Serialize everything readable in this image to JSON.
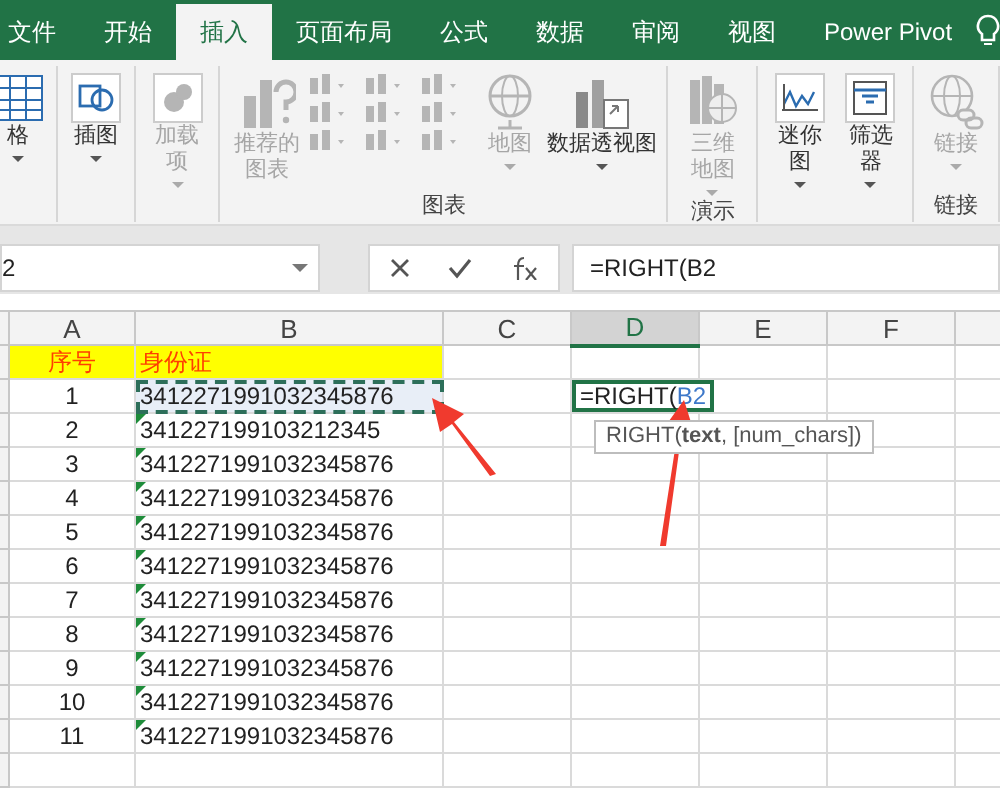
{
  "ribbon_tabs": [
    {
      "label": "文件",
      "selected": false
    },
    {
      "label": "开始",
      "selected": false
    },
    {
      "label": "插入",
      "selected": true
    },
    {
      "label": "页面布局",
      "selected": false
    },
    {
      "label": "公式",
      "selected": false
    },
    {
      "label": "数据",
      "selected": false
    },
    {
      "label": "审阅",
      "selected": false
    },
    {
      "label": "视图",
      "selected": false
    },
    {
      "label": "Power Pivot",
      "selected": false
    }
  ],
  "ribbon_groups": [
    {
      "items": [
        {
          "kind": "table",
          "label": "格",
          "dropdown": true,
          "disabled": false
        }
      ]
    },
    {
      "items": [
        {
          "kind": "shapes",
          "label": "插图",
          "dropdown": true,
          "disabled": false
        }
      ]
    },
    {
      "items": [
        {
          "kind": "addin",
          "label": "加载项",
          "dropdown": true,
          "disabled": true
        }
      ]
    },
    {
      "label": "图表",
      "items": [
        {
          "kind": "recommended",
          "label": "推荐的图表",
          "dropdown": false,
          "disabled": true
        },
        {
          "kind": "gallery",
          "dropdown": false,
          "disabled": true
        },
        {
          "kind": "globe",
          "label": "地图",
          "dropdown": true,
          "disabled": true
        },
        {
          "kind": "pivot",
          "label": "数据透视图",
          "dropdown": true,
          "disabled": false
        }
      ]
    },
    {
      "label": "演示",
      "items": [
        {
          "kind": "map3d",
          "label": "三维地图",
          "dropdown": true,
          "disabled": true
        }
      ]
    },
    {
      "items": [
        {
          "kind": "sparkline",
          "label": "迷你图",
          "dropdown": true,
          "disabled": false
        },
        {
          "kind": "filter",
          "label": "筛选器",
          "dropdown": true,
          "disabled": false
        }
      ]
    },
    {
      "label": "链接",
      "items": [
        {
          "kind": "link",
          "label": "链接",
          "dropdown": true,
          "disabled": true
        }
      ]
    }
  ],
  "formula_bar": {
    "name_box": "2",
    "formula": "=RIGHT(B2"
  },
  "columns": [
    {
      "label": "A",
      "selected": false
    },
    {
      "label": "B",
      "selected": false
    },
    {
      "label": "C",
      "selected": false
    },
    {
      "label": "D",
      "selected": true
    },
    {
      "label": "E",
      "selected": false
    },
    {
      "label": "F",
      "selected": false
    }
  ],
  "rows": [
    {
      "kind": "header",
      "number": "序号",
      "id": "身份证"
    },
    {
      "kind": "data",
      "number": "1",
      "id": "3412271991032345876",
      "error_mark": false,
      "copy_marquee": true,
      "editing": {
        "text": "=RIGHT(",
        "reference": "B2",
        "tooltip": "RIGHT(**text**, [num_chars])"
      }
    },
    {
      "kind": "data",
      "number": "2",
      "id": "341227199103212345",
      "error_mark": true,
      "copy_marquee": false
    },
    {
      "kind": "data",
      "number": "3",
      "id": "3412271991032345876",
      "error_mark": true,
      "copy_marquee": false
    },
    {
      "kind": "data",
      "number": "4",
      "id": "3412271991032345876",
      "error_mark": true,
      "copy_marquee": false
    },
    {
      "kind": "data",
      "number": "5",
      "id": "3412271991032345876",
      "error_mark": true,
      "copy_marquee": false
    },
    {
      "kind": "data",
      "number": "6",
      "id": "3412271991032345876",
      "error_mark": true,
      "copy_marquee": false
    },
    {
      "kind": "data",
      "number": "7",
      "id": "3412271991032345876",
      "error_mark": true,
      "copy_marquee": false
    },
    {
      "kind": "data",
      "number": "8",
      "id": "3412271991032345876",
      "error_mark": true,
      "copy_marquee": false
    },
    {
      "kind": "data",
      "number": "9",
      "id": "3412271991032345876",
      "error_mark": true,
      "copy_marquee": false
    },
    {
      "kind": "data",
      "number": "10",
      "id": "3412271991032345876",
      "error_mark": true,
      "copy_marquee": false
    },
    {
      "kind": "data",
      "number": "11",
      "id": "3412271991032345876",
      "error_mark": true,
      "copy_marquee": false
    }
  ]
}
